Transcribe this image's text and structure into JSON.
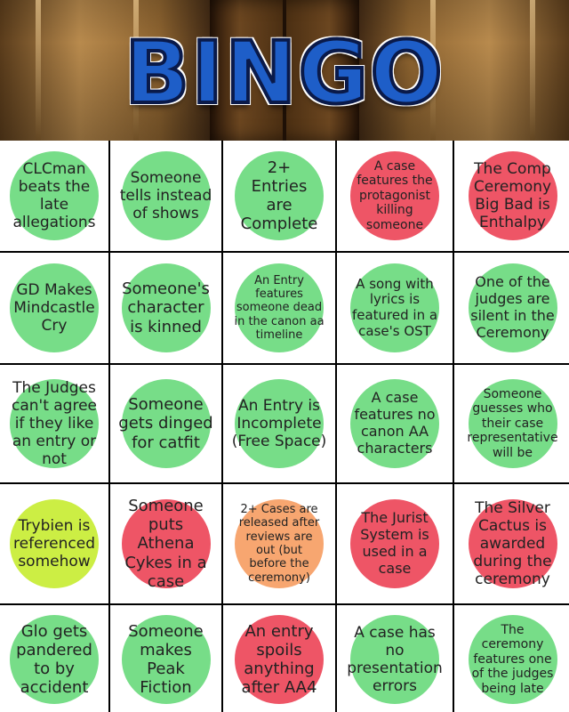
{
  "title": "BINGO",
  "colors": {
    "green": "#77dd88",
    "red": "#ee5566",
    "yellow": "#ccee44",
    "orange": "#f7a670"
  },
  "cells": [
    {
      "text": "CLCman\nbeats the\nlate\nallegations",
      "color": "green",
      "size": 17
    },
    {
      "text": "Someone\ntells instead\nof shows",
      "color": "green",
      "size": 17
    },
    {
      "text": "2+\nEntries\nare\nComplete",
      "color": "green",
      "size": 18
    },
    {
      "text": "A case\nfeatures the\nprotagonist\nkilling\nsomeone",
      "color": "red",
      "size": 14
    },
    {
      "text": "The Comp\nCeremony\nBig Bad is\nEnthalpy",
      "color": "red",
      "size": 17
    },
    {
      "text": "GD Makes\nMindcastle\nCry",
      "color": "green",
      "size": 17
    },
    {
      "text": "Someone's\ncharacter\nis kinned",
      "color": "green",
      "size": 18
    },
    {
      "text": "An Entry\nfeatures\nsomeone dead\nin the canon aa\ntimeline",
      "color": "green",
      "size": 13
    },
    {
      "text": "A song with\nlyrics is\nfeatured in a\ncase's OST",
      "color": "green",
      "size": 15
    },
    {
      "text": "One of the\njudges are\nsilent in the\nCeremony",
      "color": "green",
      "size": 16
    },
    {
      "text": "The Judges\ncan't agree\nif they like\nan entry or\nnot",
      "color": "green",
      "size": 17
    },
    {
      "text": "Someone\ngets dinged\nfor catfit",
      "color": "green",
      "size": 18
    },
    {
      "text": "An Entry is\nIncomplete\n(Free Space)",
      "color": "green",
      "size": 17
    },
    {
      "text": "A case\nfeatures no\ncanon AA\ncharacters",
      "color": "green",
      "size": 16
    },
    {
      "text": "Someone\nguesses who\ntheir case\nrepresentative\nwill be",
      "color": "green",
      "size": 14
    },
    {
      "text": "Trybien is\nreferenced\nsomehow",
      "color": "yellow",
      "size": 17
    },
    {
      "text": "Someone\nputs\nAthena\nCykes in a\ncase",
      "color": "red",
      "size": 18
    },
    {
      "text": "2+ Cases are\nreleased after\nreviews are\nout (but\nbefore the\nceremony)",
      "color": "orange",
      "size": 13
    },
    {
      "text": "The Jurist\nSystem is\nused in a\ncase",
      "color": "red",
      "size": 16
    },
    {
      "text": "The Silver\nCactus is\nawarded\nduring the\nceremony",
      "color": "red",
      "size": 17
    },
    {
      "text": "Glo gets\npandered\nto by\naccident",
      "color": "green",
      "size": 18
    },
    {
      "text": "Someone\nmakes\nPeak\nFiction",
      "color": "green",
      "size": 18
    },
    {
      "text": "An entry\nspoils\nanything\nafter AA4",
      "color": "red",
      "size": 18
    },
    {
      "text": "A case has\nno\npresentation\nerrors",
      "color": "green",
      "size": 17
    },
    {
      "text": "The\nceremony\nfeatures one\nof the judges\nbeing late",
      "color": "green",
      "size": 14
    }
  ]
}
